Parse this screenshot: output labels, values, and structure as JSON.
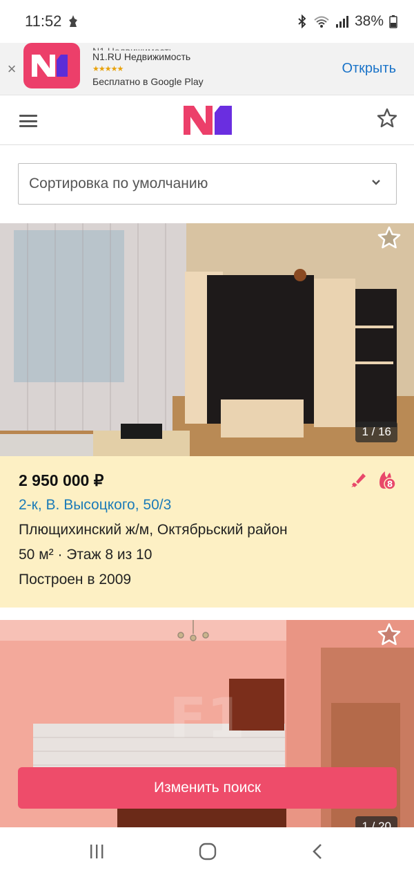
{
  "status": {
    "time": "11:52",
    "battery": "38%"
  },
  "banner": {
    "close": "×",
    "logo": "N1",
    "title_partial": "N1 Недвижимость",
    "app_name": "N1.RU Недвижимость",
    "stars": "★★★★★",
    "subtitle": "Бесплатно в Google Play",
    "open": "Открыть"
  },
  "header": {
    "logo": "N1"
  },
  "sort": {
    "label": "Сортировка по умолчанию"
  },
  "listings": [
    {
      "counter": "1 / 16",
      "price": "2 950 000 ₽",
      "address": "2-к, В. Высоцкого, 50/3",
      "district": "Плющихинский ж/м, Октябрьский район",
      "area_floor": "50 м² · Этаж 8 из 10",
      "built": "Построен в 2009",
      "badge_count": "8"
    },
    {
      "counter": "1 / 20"
    }
  ],
  "cta": {
    "label": "Изменить поиск"
  },
  "colors": {
    "brand": "#ec3f6a",
    "link": "#1b7bb8",
    "card_bg": "#fdf0c4",
    "cta": "#ee4c6a"
  }
}
